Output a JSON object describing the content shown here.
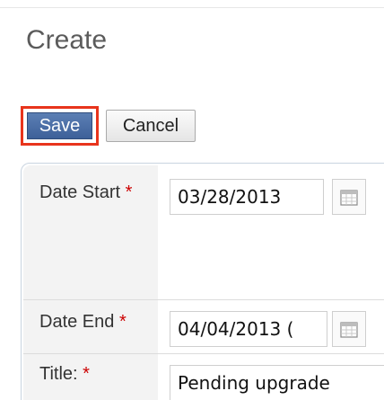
{
  "header": {
    "title": "Create"
  },
  "toolbar": {
    "save_label": "Save",
    "cancel_label": "Cancel"
  },
  "form": {
    "required_marker": "*",
    "date_start": {
      "label": "Date Start",
      "value": "03/28/2013"
    },
    "date_end": {
      "label": "Date End",
      "value": "04/04/2013 ("
    },
    "title": {
      "label": "Title:",
      "value": "Pending upgrade"
    }
  },
  "icons": {
    "calendar": "calendar-icon"
  },
  "colors": {
    "save_bg": "#4a6ea8",
    "highlight_border": "#e8341c",
    "required": "#cc0000",
    "label_bg": "#f3f3f3"
  }
}
